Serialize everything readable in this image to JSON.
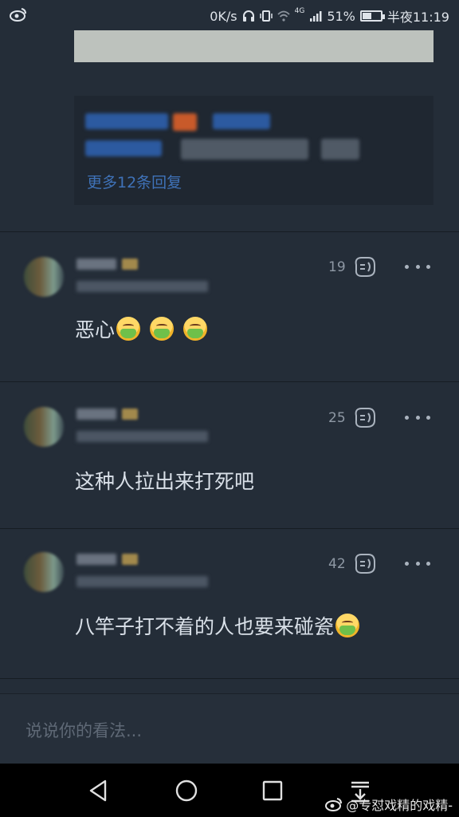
{
  "status_bar": {
    "speed": "0K/s",
    "signal_label": "4G",
    "battery_percent": "51%",
    "time": "半夜11:19",
    "battery_level": 0.51
  },
  "thread": {
    "more_replies_label": "更多12条回复"
  },
  "comments": [
    {
      "likes": "19",
      "text": "恶心",
      "emoji_count": 3
    },
    {
      "likes": "25",
      "text": "这种人拉出来打死吧",
      "emoji_count": 0
    },
    {
      "likes": "42",
      "text": "八竿子打不着的人也要来碰瓷",
      "emoji_count": 1
    }
  ],
  "input": {
    "placeholder": "说说你的看法..."
  },
  "nav": {
    "icons": [
      "back-icon",
      "home-icon",
      "recents-icon",
      "notification-shade-icon"
    ]
  },
  "watermark": {
    "text": "@专怼戏精的戏精-"
  },
  "colors": {
    "background": "#242d38",
    "link": "#3f72b8",
    "emoji_face": "#ffd866",
    "emoji_vomit": "#6fc04a"
  }
}
